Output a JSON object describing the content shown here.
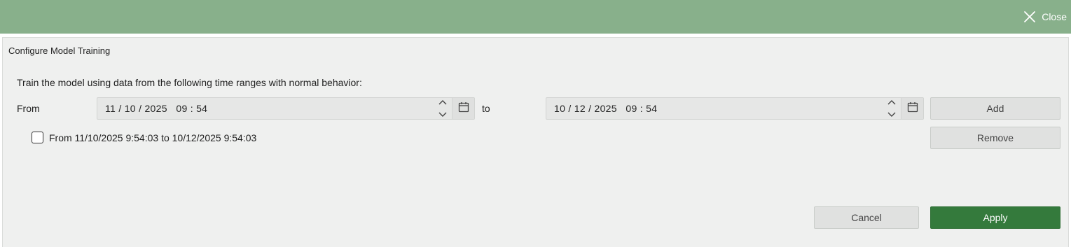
{
  "header": {
    "close_label": "Close"
  },
  "panel": {
    "title": "Configure Model Training",
    "instruction": "Train the model using data from the following time ranges with normal behavior:",
    "from_label": "From",
    "to_label": "to",
    "from_value": "11 / 10 / 2025   09 : 54",
    "to_value": "10 / 12 / 2025   09 : 54",
    "add_label": "Add",
    "remove_label": "Remove",
    "ranges": [
      {
        "label": "From 11/10/2025 9:54:03 to 10/12/2025 9:54:03",
        "checked": false
      }
    ]
  },
  "footer": {
    "cancel_label": "Cancel",
    "apply_label": "Apply"
  },
  "colors": {
    "header_bg": "#88b08b",
    "apply_bg": "#347a3c",
    "panel_bg": "#eff0ef"
  },
  "icons": [
    "close-icon",
    "chevron-up-icon",
    "chevron-down-icon",
    "calendar-icon",
    "checkbox-icon"
  ]
}
